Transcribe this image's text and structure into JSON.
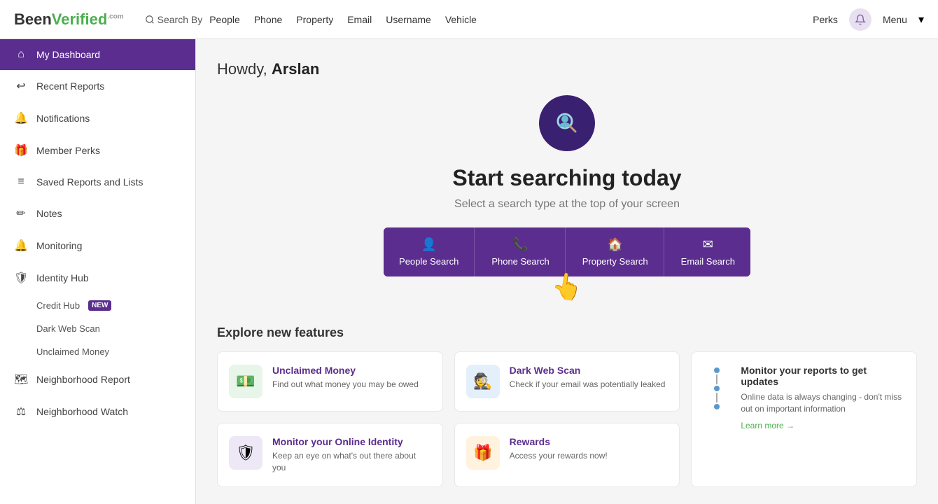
{
  "header": {
    "logo_text": "BeenVerified",
    "logo_green": "Verified",
    "logo_sup": "com",
    "search_by_label": "Search By",
    "nav_items": [
      "People",
      "Phone",
      "Property",
      "Email",
      "Username",
      "Vehicle"
    ],
    "perks_label": "Perks",
    "menu_label": "Menu"
  },
  "sidebar": {
    "items": [
      {
        "id": "dashboard",
        "label": "My Dashboard",
        "icon": "🏠",
        "active": true
      },
      {
        "id": "recent-reports",
        "label": "Recent Reports",
        "icon": "↩"
      },
      {
        "id": "notifications",
        "label": "Notifications",
        "icon": "🔔"
      },
      {
        "id": "member-perks",
        "label": "Member Perks",
        "icon": "🎁"
      },
      {
        "id": "saved-reports",
        "label": "Saved Reports and Lists",
        "icon": "☰"
      },
      {
        "id": "notes",
        "label": "Notes",
        "icon": "✏️"
      },
      {
        "id": "monitoring",
        "label": "Monitoring",
        "icon": "🔔"
      },
      {
        "id": "identity-hub",
        "label": "Identity Hub",
        "icon": "🛡"
      }
    ],
    "sub_items": [
      {
        "id": "credit-hub",
        "label": "Credit Hub",
        "badge": "NEW"
      },
      {
        "id": "dark-web-scan",
        "label": "Dark Web Scan"
      },
      {
        "id": "unclaimed-money",
        "label": "Unclaimed Money"
      }
    ],
    "bottom_items": [
      {
        "id": "neighborhood-report",
        "label": "Neighborhood Report",
        "icon": "🗺"
      },
      {
        "id": "neighborhood-watch",
        "label": "Neighborhood Watch",
        "icon": "⚖"
      }
    ]
  },
  "main": {
    "greeting": "Howdy, ",
    "username": "Arslan",
    "hero_title": "Start searching today",
    "hero_subtitle": "Select a search type at the top of your screen",
    "search_buttons": [
      {
        "id": "people-search",
        "label": "People Search",
        "icon": "👤"
      },
      {
        "id": "phone-search",
        "label": "Phone Search",
        "icon": "📞"
      },
      {
        "id": "property-search",
        "label": "Property Search",
        "icon": "🏠"
      },
      {
        "id": "email-search",
        "label": "Email Search",
        "icon": "✉"
      }
    ],
    "explore_title": "Explore new features",
    "features": [
      {
        "id": "unclaimed-money",
        "title": "Unclaimed Money",
        "desc": "Find out what money you may be owed",
        "icon_color": "green",
        "icon": "💵"
      },
      {
        "id": "dark-web-scan",
        "title": "Dark Web Scan",
        "desc": "Check if your email was potentially leaked",
        "icon_color": "blue",
        "icon": "🕵️"
      },
      {
        "id": "monitor-online",
        "title": "Monitor your Online Identity",
        "desc": "Keep an eye on what's out there about you",
        "icon_color": "purple",
        "icon": "🛡"
      },
      {
        "id": "rewards",
        "title": "Rewards",
        "desc": "Access your rewards now!",
        "icon_color": "orange",
        "icon": "🎁"
      }
    ],
    "monitor_card": {
      "title": "Monitor your reports to get updates",
      "desc": "Online data is always changing - don't miss out on important information",
      "learn_more": "Learn more →"
    }
  }
}
